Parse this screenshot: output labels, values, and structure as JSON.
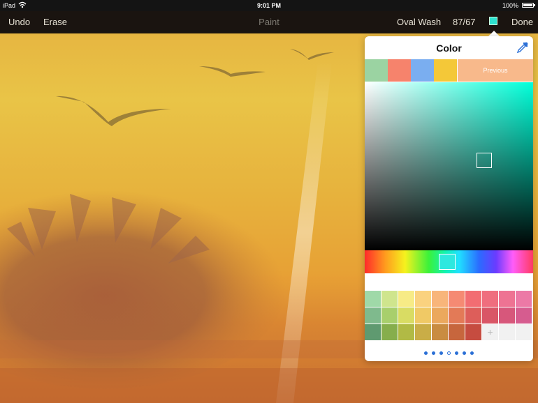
{
  "status_bar": {
    "device": "iPad",
    "time": "9:01 PM",
    "battery": "100%",
    "battery_level": 1.0
  },
  "toolbar": {
    "undo": "Undo",
    "erase": "Erase",
    "title": "Paint",
    "brush": "Oval Wash",
    "size": "87/67",
    "current_color": "#2ee2d0",
    "done": "Done"
  },
  "color_popover": {
    "title": "Color",
    "eyedropper_icon": "eyedropper-icon",
    "recent_colors": [
      "#9bd3a2",
      "#f6836c",
      "#7aaef0",
      "#f4c838"
    ],
    "previous_label": "Previous",
    "previous_color": "#f8b98b",
    "hue_color": "#00ffd9",
    "selected_color": "#2ee8df",
    "palette_rows": [
      [
        "#9fd9a8",
        "#cfe58d",
        "#f7eb86",
        "#fad27f",
        "#f8b57a",
        "#f58a73",
        "#f26d72",
        "#ef6e7e",
        "#ee7393",
        "#ec79a6"
      ],
      [
        "#7fba8d",
        "#a8cf6c",
        "#d9dc63",
        "#f0c965",
        "#eba85d",
        "#e37a57",
        "#dd5e5a",
        "#d95666",
        "#d7577b",
        "#d65c8f"
      ],
      [
        "#5f9a70",
        "#86ae4c",
        "#b1ba45",
        "#c9ad47",
        "#c98c41",
        "#c7663d",
        "#c64c40",
        null,
        null,
        null
      ]
    ],
    "add_label": "+",
    "page_count": 7,
    "current_page": 3
  }
}
